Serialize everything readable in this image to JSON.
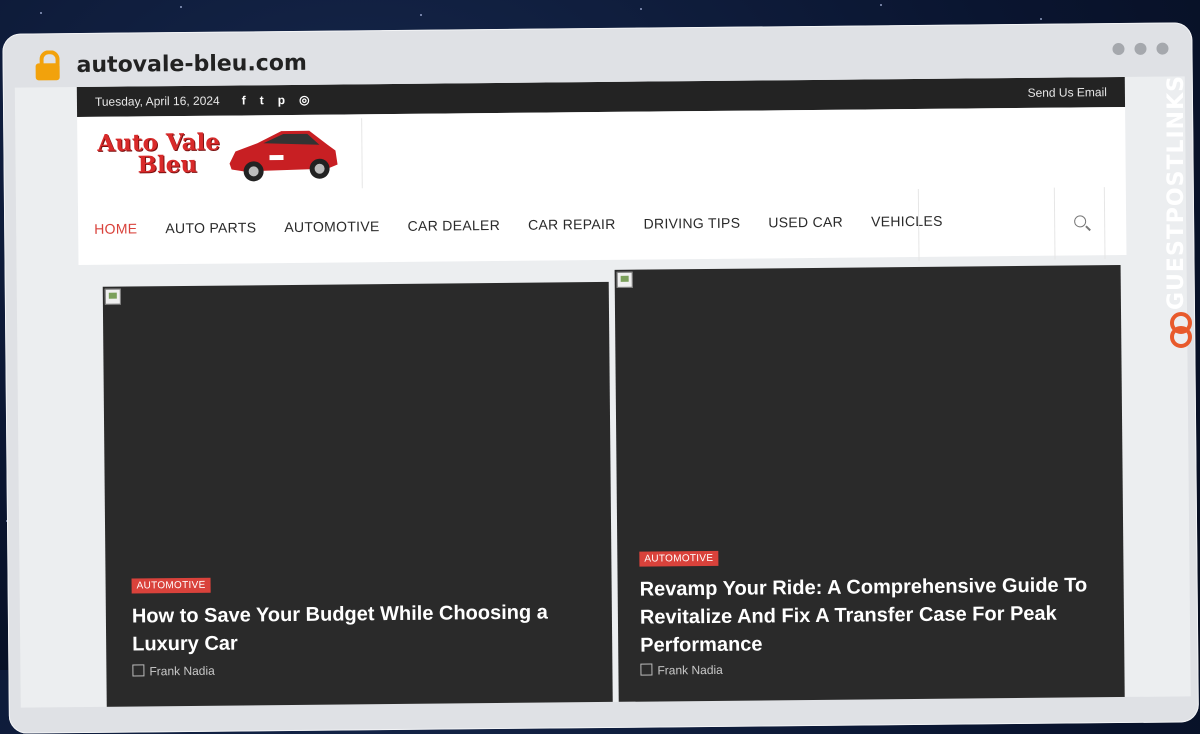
{
  "browser": {
    "url": "autovale-bleu.com"
  },
  "site": {
    "topbar": {
      "date": "Tuesday, April 16, 2024",
      "social": [
        "f",
        "t",
        "p",
        "ig"
      ],
      "send_email": "Send Us Email"
    },
    "logo": {
      "line1": "Auto Vale",
      "line2": "Bleu"
    },
    "nav": [
      "HOME",
      "AUTO PARTS",
      "AUTOMOTIVE",
      "CAR DEALER",
      "CAR REPAIR",
      "DRIVING TIPS",
      "USED CAR",
      "VEHICLES"
    ],
    "active_nav": "HOME"
  },
  "posts": [
    {
      "category": "AUTOMOTIVE",
      "title": "How to Save Your Budget While Choosing a Luxury Car",
      "author": "Frank Nadia"
    },
    {
      "category": "AUTOMOTIVE",
      "title": "Revamp Your Ride: A Comprehensive Guide To Revitalize And Fix A Transfer Case For Peak Performance",
      "author": "Frank Nadia"
    }
  ],
  "watermark": {
    "text": "GUESTPOSTLINKS"
  },
  "colors": {
    "accent": "#d9423b",
    "topbar": "#232323",
    "card": "#2a2a2a",
    "brand_orange": "#e85a2c"
  }
}
